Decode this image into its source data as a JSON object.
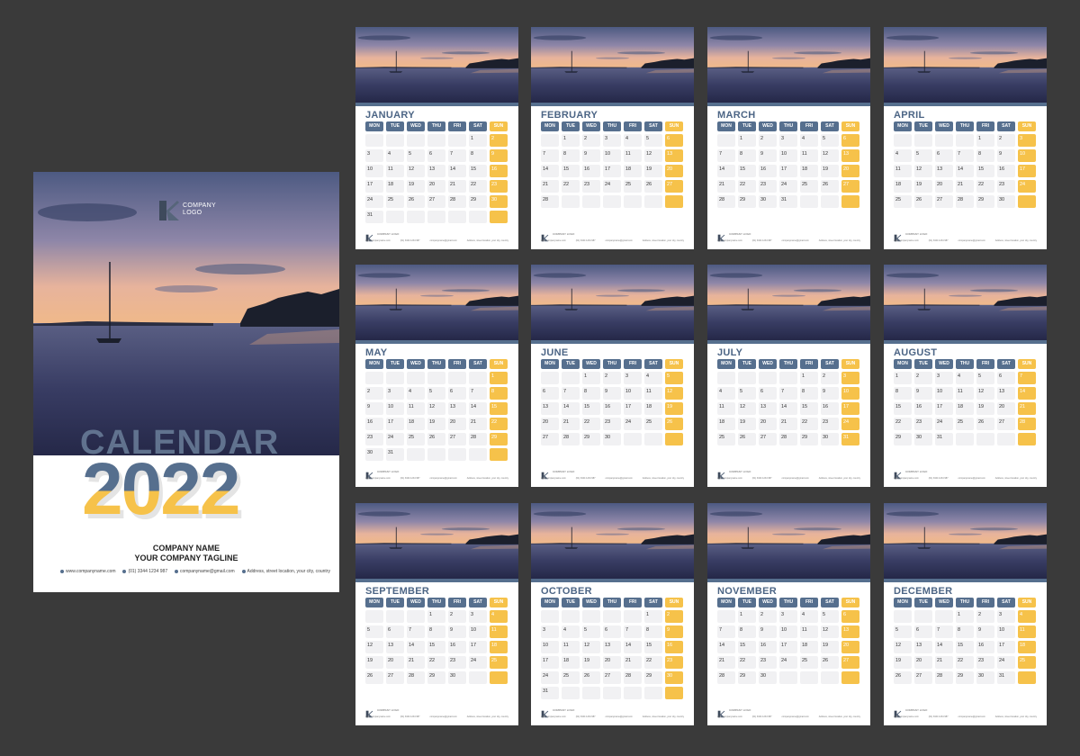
{
  "cover": {
    "logo_text": "COMPANY LOGO",
    "title_word": "CALENDAR",
    "year": "2022",
    "company_name": "COMPANY NAME",
    "tagline": "YOUR COMPANY TAGLINE",
    "website": "www.companyname.com",
    "phone": "(01) 3344 1234 987",
    "email": "companyname@gmail.com",
    "address": "Address, street location, your city, country"
  },
  "weekdays": [
    "MON",
    "TUE",
    "WED",
    "THU",
    "FRI",
    "SAT",
    "SUN"
  ],
  "colors": {
    "accent_blue": "#566f8e",
    "accent_yellow": "#f6c24a",
    "background": "#3a3a3a"
  },
  "page_footer": {
    "logo_text": "COMPANY LOGO",
    "website": "www.companyname.com",
    "phone": "(01) 3344 1234 987",
    "email": "companyname@gmail.com",
    "address": "Address, street location, your city, country"
  },
  "months": [
    {
      "name": "JANUARY",
      "start": "2022-01-01",
      "days": 31
    },
    {
      "name": "FEBRUARY",
      "start": "2022-02-01",
      "days": 28
    },
    {
      "name": "MARCH",
      "start": "2022-03-01",
      "days": 31
    },
    {
      "name": "APRIL",
      "start": "2022-04-01",
      "days": 30
    },
    {
      "name": "MAY",
      "start": "2022-05-01",
      "days": 31
    },
    {
      "name": "JUNE",
      "start": "2022-06-01",
      "days": 30
    },
    {
      "name": "JULY",
      "start": "2022-07-01",
      "days": 31
    },
    {
      "name": "AUGUST",
      "start": "2022-08-01",
      "days": 31
    },
    {
      "name": "SEPTEMBER",
      "start": "2022-09-01",
      "days": 30
    },
    {
      "name": "OCTOBER",
      "start": "2022-10-01",
      "days": 31
    },
    {
      "name": "NOVEMBER",
      "start": "2022-11-01",
      "days": 30
    },
    {
      "name": "DECEMBER",
      "start": "2022-12-01",
      "days": 31
    }
  ]
}
